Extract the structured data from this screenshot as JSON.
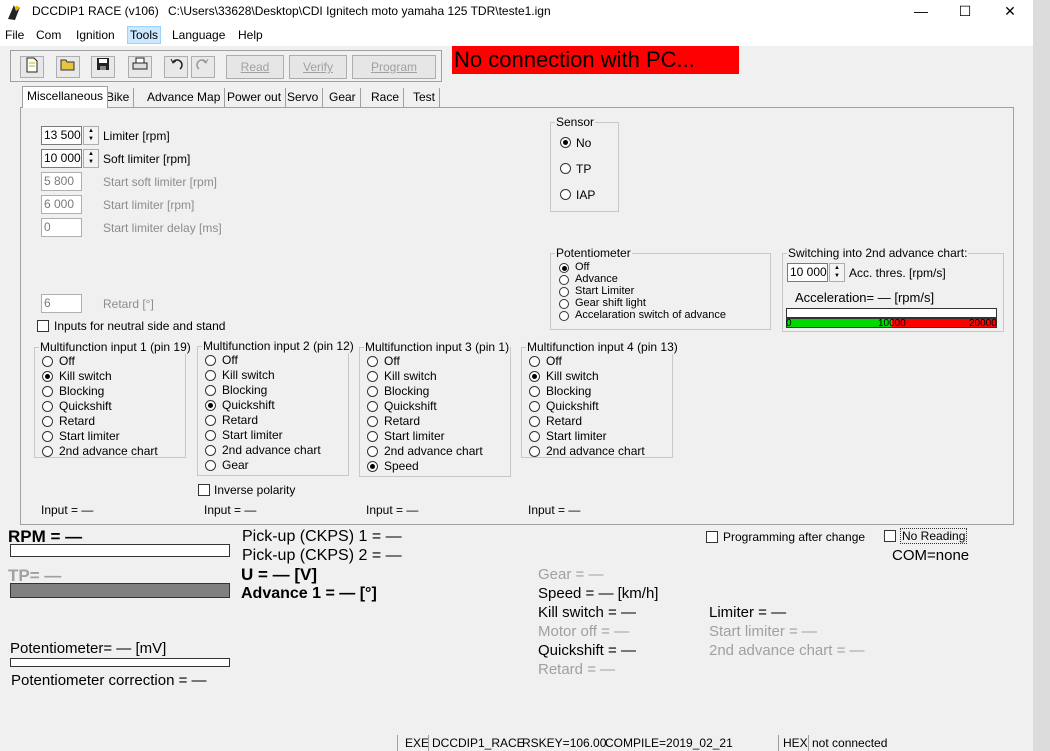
{
  "window": {
    "app_title": "DCCDIP1 RACE (v106)",
    "file_path": "C:\\Users\\33628\\Desktop\\CDI Ignitech  moto yamaha 125 TDR\\teste1.ign",
    "minimize": "—",
    "maximize": "☐",
    "close": "✕"
  },
  "menu": {
    "file": "File",
    "com": "Com",
    "ignition": "Ignition",
    "tools": "Tools",
    "language": "Language",
    "help": "Help"
  },
  "toolbar": {
    "read": "Read",
    "verify": "Verify",
    "program": "Program"
  },
  "no_connection": "No connection with PC...",
  "tabs": [
    "Miscellaneous",
    "Bike",
    "Advance Map",
    "Power out",
    "Servo",
    "Gear",
    "Race",
    "Test"
  ],
  "misc": {
    "limiter": {
      "value": "13 500",
      "label": "Limiter [rpm]"
    },
    "soft_limiter": {
      "value": "10 000",
      "label": "Soft limiter [rpm]"
    },
    "start_soft_limiter": {
      "value": "5 800",
      "label": "Start soft limiter [rpm]"
    },
    "start_limiter": {
      "value": "6 000",
      "label": "Start limiter [rpm]"
    },
    "start_limiter_delay": {
      "value": "0",
      "label": "Start limiter delay [ms]"
    },
    "retard": {
      "value": "6",
      "label": "Retard [°]"
    },
    "neutral_inputs": "Inputs for neutral side and stand",
    "inverse_polarity": "Inverse polarity"
  },
  "sensor": {
    "title": "Sensor",
    "options": [
      "No",
      "TP",
      "IAP"
    ],
    "selected": 0
  },
  "potentiometer": {
    "title": "Potentiometer",
    "options": [
      "Off",
      "Advance",
      "Start Limiter",
      "Gear shift light",
      "Accelaration switch of advance"
    ],
    "selected": 0
  },
  "switching": {
    "title": "Switching into 2nd advance chart:",
    "value": "10 000",
    "label": "Acc. thres. [rpm/s]",
    "acceleration": "Acceleration= — [rpm/s]",
    "scale": [
      "0",
      "10000",
      "20000"
    ],
    "green_fraction": 0.5,
    "green_color": "#00d800",
    "red_color": "#ff0000"
  },
  "multifunction": [
    {
      "title": "Multifunction input 1 (pin 19)",
      "options": [
        "Off",
        "Kill switch",
        "Blocking",
        "Quickshift",
        "Retard",
        "Start limiter",
        "2nd advance chart"
      ],
      "selected": 1,
      "input": "Input = —"
    },
    {
      "title": "Multifunction input 2 (pin 12)",
      "options": [
        "Off",
        "Kill switch",
        "Blocking",
        "Quickshift",
        "Retard",
        "Start limiter",
        "2nd advance chart",
        "Gear"
      ],
      "selected": 3,
      "input": "Input = —"
    },
    {
      "title": "Multifunction input 3 (pin 1)",
      "options": [
        "Off",
        "Kill switch",
        "Blocking",
        "Quickshift",
        "Retard",
        "Start limiter",
        "2nd advance chart",
        "Speed"
      ],
      "selected": 7,
      "input": "Input = —"
    },
    {
      "title": "Multifunction input 4 (pin 13)",
      "options": [
        "Off",
        "Kill switch",
        "Blocking",
        "Quickshift",
        "Retard",
        "Start limiter",
        "2nd advance chart"
      ],
      "selected": 1,
      "input": "Input = —"
    }
  ],
  "readout": {
    "rpm": "RPM = —",
    "tp": "TP= —",
    "pickup1": "Pick-up (CKPS) 1 =  —",
    "pickup2": "Pick-up (CKPS) 2 =  —",
    "voltage": "U = — [V]",
    "advance1": "Advance 1 = — [°]",
    "gear": "Gear = —",
    "speed": "Speed = — [km/h]",
    "kill_switch": "Kill switch = —",
    "motor_off": "Motor off = —",
    "quickshift": "Quickshift = —",
    "retard": "Retard = —",
    "limiter": "Limiter = —",
    "start_limiter": "Start limiter = —",
    "second_chart": "2nd advance chart = —",
    "potentiometer": "Potentiometer= — [mV]",
    "pot_correction": "Potentiometer correction = —",
    "programming_after_change": "Programming after change",
    "no_reading": "No Reading",
    "com": "COM=none",
    "tp_bar_color": "#808080"
  },
  "statusbar": {
    "exe_label": "EXE",
    "exe_value": "DCCDIP1_RACE",
    "rskey": "RSKEY=106.00",
    "compile": "COMPILE=2019_02_21",
    "hex_label": "HEX",
    "hex_value": "not connected"
  }
}
